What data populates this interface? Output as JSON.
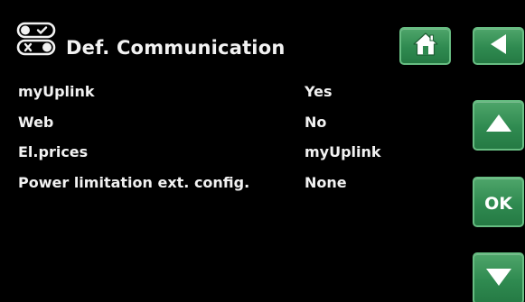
{
  "header": {
    "title": "Def. Communication",
    "icon": "toggle-switches-icon"
  },
  "buttons": {
    "home": {
      "icon": "home-icon"
    },
    "back": {
      "icon": "back-arrow-icon"
    },
    "up": {
      "icon": "up-arrow-icon"
    },
    "ok": {
      "label": "OK"
    },
    "down": {
      "icon": "down-arrow-icon"
    }
  },
  "settings": [
    {
      "label": "myUplink",
      "value": "Yes"
    },
    {
      "label": "Web",
      "value": "No"
    },
    {
      "label": "El.prices",
      "value": "myUplink"
    },
    {
      "label": "Power limitation ext. config.",
      "value": "None"
    }
  ],
  "colors": {
    "background": "#000000",
    "text": "#f2f2f2",
    "button_green": "#2f8a50"
  }
}
